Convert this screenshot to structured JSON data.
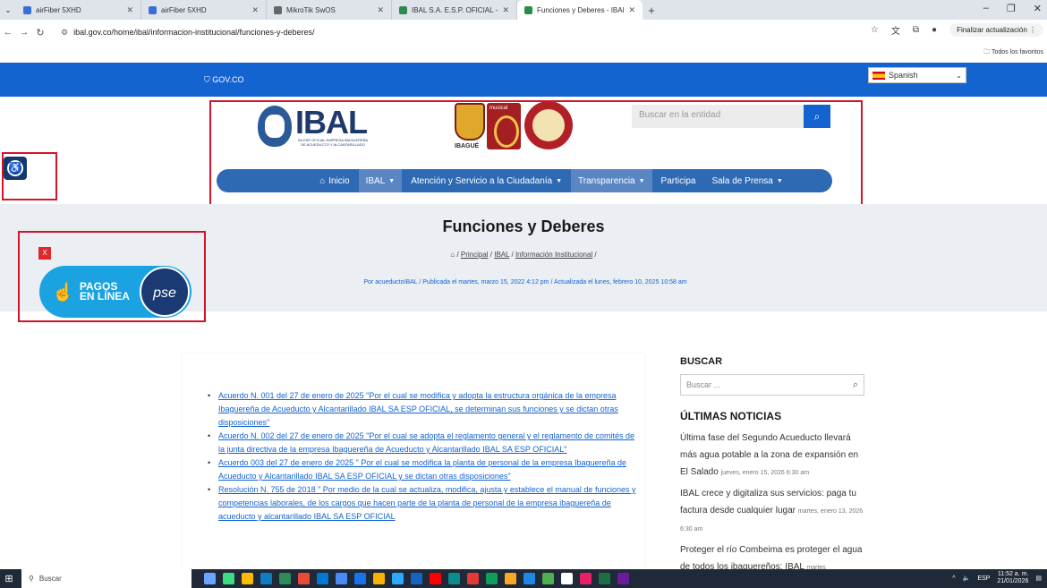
{
  "browser": {
    "tabs": [
      {
        "title": "airFiber 5XHD",
        "fav_color": "#3a6fd8",
        "active": false
      },
      {
        "title": "airFiber 5XHD",
        "fav_color": "#3a6fd8",
        "active": false
      },
      {
        "title": "MikroTik SwOS",
        "fav_color": "#666666",
        "active": false
      },
      {
        "title": "IBAL S.A. E.S.P. OFICIAL - IBAL",
        "fav_color": "#2d8a4e",
        "active": false
      },
      {
        "title": "Funciones y Deberes - IBAL SA",
        "fav_color": "#2d8a4e",
        "active": true
      }
    ],
    "url": "ibal.gov.co/home/ibal/informacion-institucional/funciones-y-deberes/",
    "update_label": "Finalizar actualización",
    "bookmarks_folder": "Todos los favoritos"
  },
  "site": {
    "gov_label": "GOV.CO",
    "language": "Spanish",
    "crest_label": "IBAGUÉ",
    "musical_label": "musical",
    "ibal_name": "IBAL",
    "ibal_subtitle": "SA ESP OFICIAL EMPRESA IBAGUEREÑA DE ACUEDUCTO Y ALCANTARILLADO",
    "search_placeholder": "Buscar en la entidad",
    "nav": [
      {
        "label": "Inicio",
        "icon": "home-icon",
        "dropdown": false
      },
      {
        "label": "IBAL",
        "dropdown": true,
        "active": true
      },
      {
        "label": "Atención y Servicio a la Ciudadanía",
        "dropdown": true
      },
      {
        "label": "Transparencia",
        "dropdown": true,
        "active": true
      },
      {
        "label": "Participa",
        "dropdown": false
      },
      {
        "label": "Sala de Prensa",
        "dropdown": true
      }
    ]
  },
  "page": {
    "title": "Funciones y Deberes",
    "breadcrumb": [
      "Principal",
      "IBAL",
      "Información Institucional"
    ],
    "meta": "Por acueductoIBAL / Publicada el martes, marzo 15, 2022 4:12 pm / Actualizada el lunes, febrero 10, 2025 10:58 am",
    "documents": [
      "Acuerdo N. 001 del 27 de enero de 2025 \"Por el cual se modifica y adopta la estructura orgánica de la empresa Ibaguereña de Acueducto y Alcantarillado IBAL SA ESP OFICIAL, se determinan sus funciones y se dictan otras disposiciones\"",
      "Acuerdo N. 002 del 27 de enero de 2025 \"Por el cual se adopta el reglamento general y el reglamento de comités de la junta directiva de la empresa Ibaguereña de Acueducto y Alcantarillado IBAL SA ESP OFICIAL\"",
      "Acuerdo 003 del 27 de enero de 2025 \" Por el cual se modifica la planta de personal de la empresa Ibaguereña de Acueducto y Alcantarillado IBAL SA ESP OFICIAL y se dictan otras disposiciones\"",
      "Resolución N. 755 de 2018 \" Por medio de la cual se actualiza, modifica, ajusta y establece el manual de funciones y competencias laborales, de los cargos que hacen parte de la planta de personal de la empresa ibaguereña de acueducto y alcantarillado IBAL SA ESP OFICIAL"
    ]
  },
  "pse": {
    "close_label": "X",
    "label": "PAGOS EN LÍNEA",
    "brand": "pse"
  },
  "sidebar": {
    "search_heading": "BUSCAR",
    "search_placeholder": "Buscar ...",
    "news_heading": "ÚLTIMAS NOTICIAS",
    "news": [
      {
        "title": "Última fase del Segundo Acueducto llevará más agua potable a la zona de expansión en El Salado",
        "date": "jueves, enero 15, 2026 6:30 am"
      },
      {
        "title": "IBAL crece y digitaliza sus servicios: paga tu factura desde cualquier lugar",
        "date": "martes, enero 13, 2026 6:30 am"
      },
      {
        "title": "Proteger el río Combeima es proteger el agua de todos los ibaguereños: IBAL",
        "date": "martes"
      }
    ]
  },
  "taskbar": {
    "search_label": "Buscar",
    "lang": "ESP",
    "time": "11:52 a. m.",
    "date": "21/01/2026",
    "icon_colors": [
      "#6aa6ff",
      "#3ddc84",
      "#ffb900",
      "#0f7dc2",
      "#2e8b57",
      "#e94b35",
      "#0078d4",
      "#4b8bf4",
      "#1a73e8",
      "#f4b400",
      "#2ea8ff",
      "#1565c0",
      "#ff0000",
      "#0a8d8d",
      "#e53935",
      "#0f9d58",
      "#f9a825",
      "#1e88e5",
      "#4caf50",
      "#ffffff",
      "#e91e63",
      "#1d6f42",
      "#6a1b9a"
    ]
  },
  "colors": {
    "gov_blue": "#1363d0",
    "nav_blue": "#2d6ab3",
    "annotation_red": "#d2152b",
    "link_blue": "#1363d0"
  }
}
